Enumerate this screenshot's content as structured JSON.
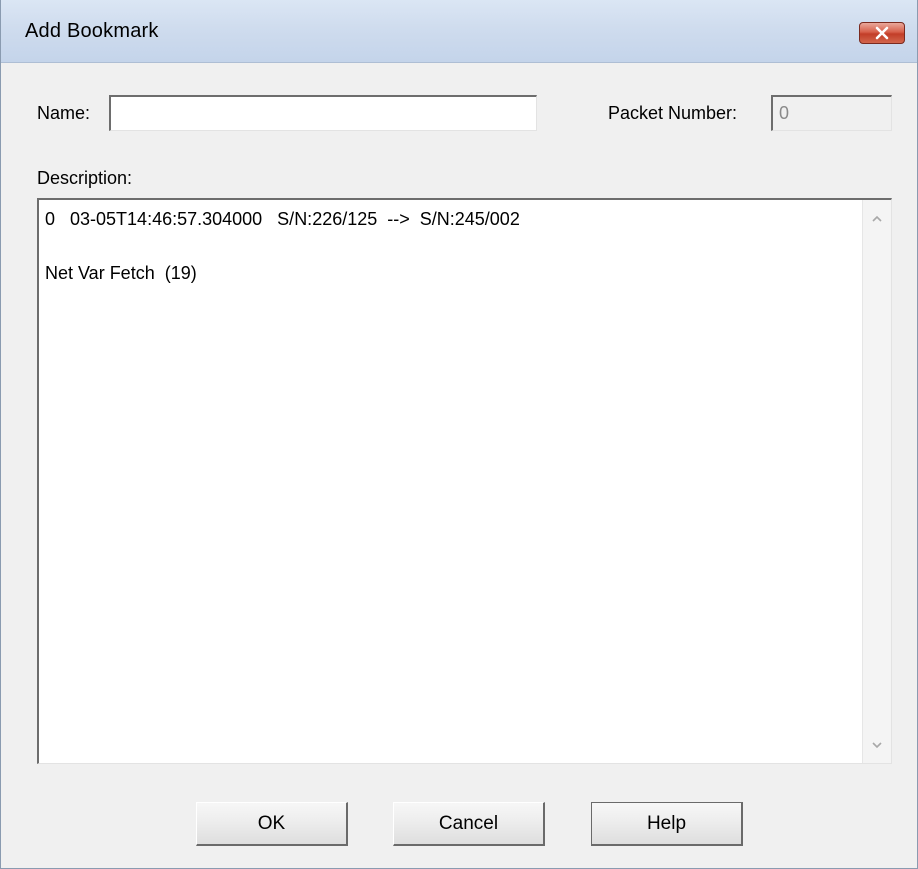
{
  "window": {
    "title": "Add Bookmark",
    "close_icon": "close-icon"
  },
  "form": {
    "name_label": "Name:",
    "name_value": "",
    "packet_number_label": "Packet Number:",
    "packet_number_value": "0",
    "description_label": "Description:",
    "description_lines": [
      "0   03-05T14:46:57.304000   S/N:226/125  -->  S/N:245/002",
      "",
      "Net Var Fetch  (19)"
    ]
  },
  "buttons": {
    "ok": "OK",
    "cancel": "Cancel",
    "help": "Help"
  },
  "colors": {
    "titlebar": "#cfdcee",
    "close_button": "#d2654c",
    "dialog_background": "#f0f0f0"
  }
}
